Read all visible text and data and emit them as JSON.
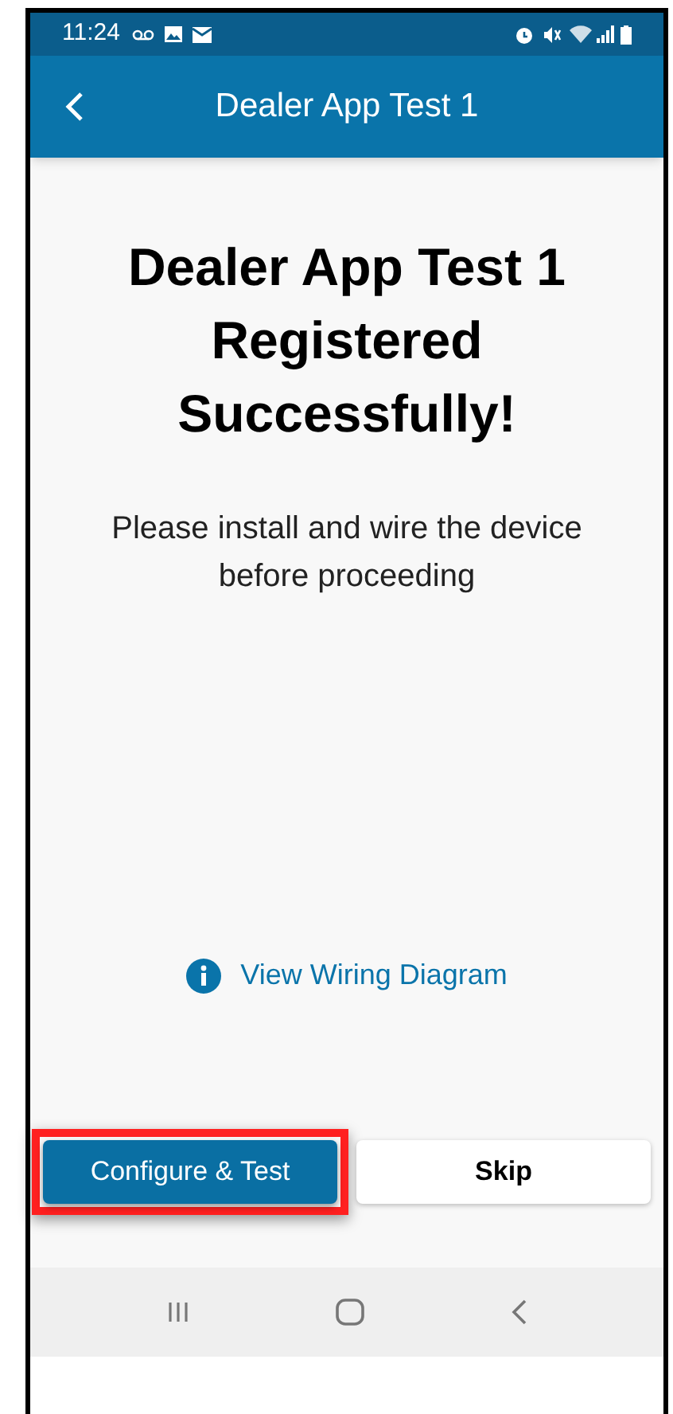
{
  "status_bar": {
    "time": "11:24"
  },
  "app_bar": {
    "title": "Dealer App Test 1"
  },
  "heading": "Dealer App Test 1 Registered Successfully!",
  "message": "Please install and wire the device before proceeding",
  "link": "View Wiring Diagram",
  "buttons": [
    {
      "label": "Configure & Test",
      "kind": "primary",
      "highlighted": true
    },
    {
      "label": "Skip",
      "kind": "secondary",
      "highlighted": false
    }
  ]
}
